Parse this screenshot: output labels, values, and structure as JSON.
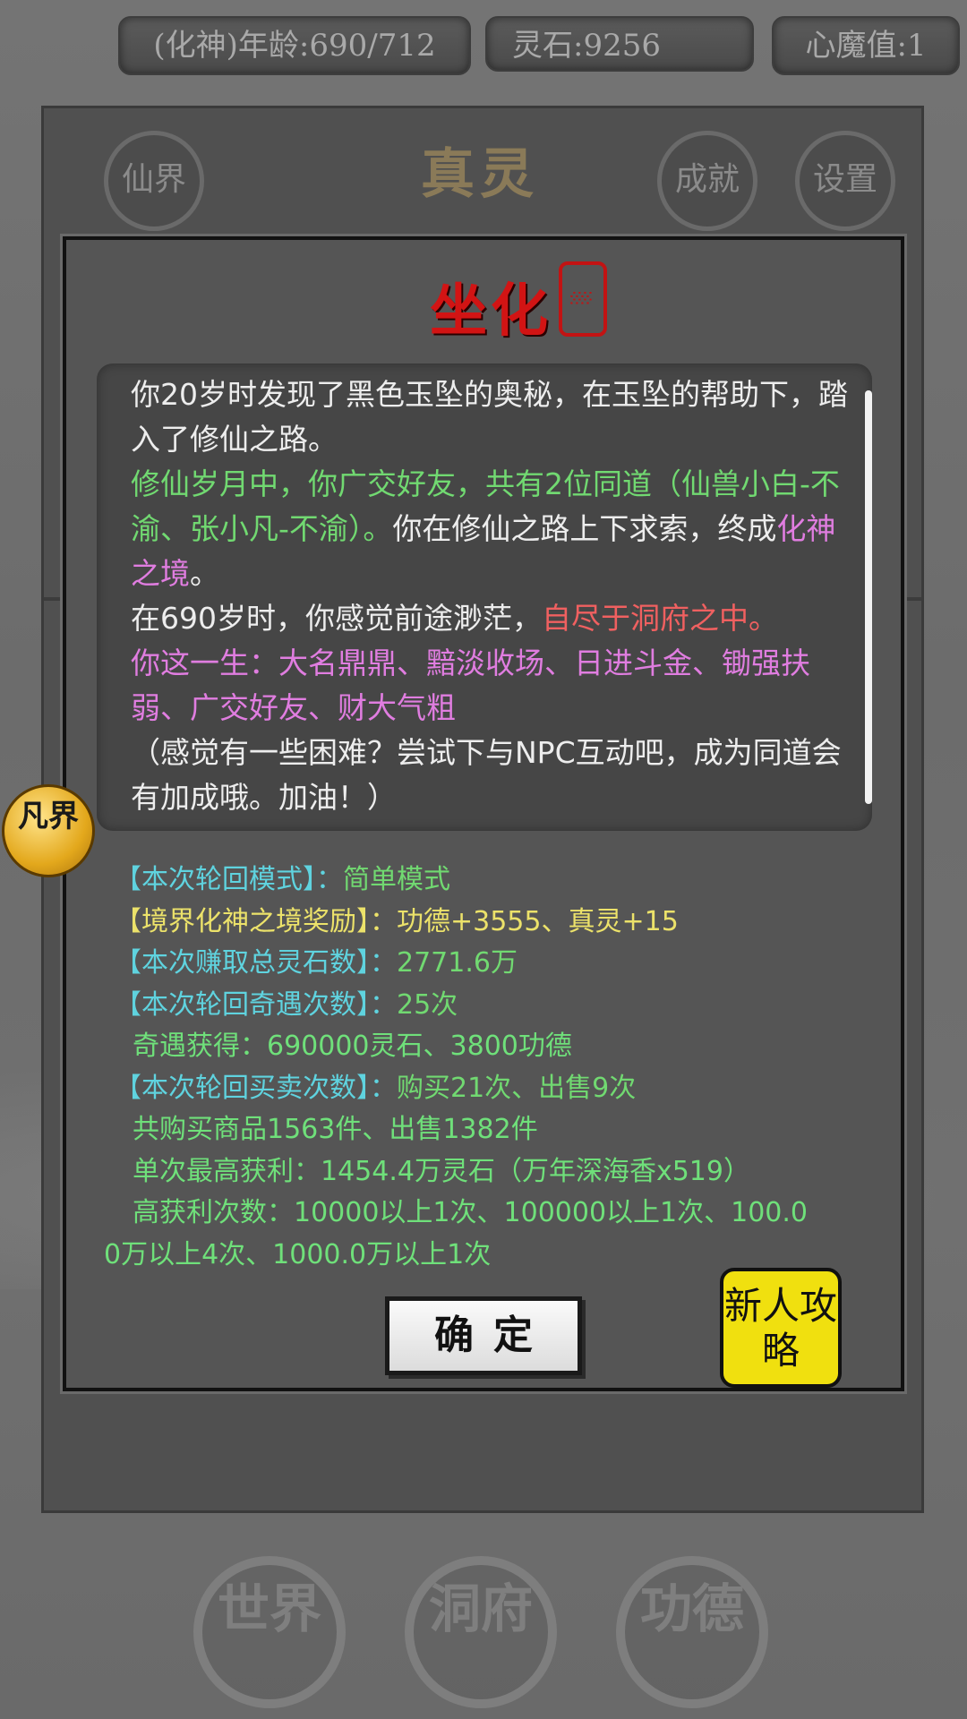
{
  "stats": {
    "age": "(化神)年龄:690/712",
    "spirit_stone": "灵石:9256",
    "heart_demon": "心魔值:1"
  },
  "top_nav": {
    "xianjie": "仙界",
    "title": "真灵",
    "chengjiu": "成就",
    "shezhi": "设置"
  },
  "modal": {
    "title": "坐化",
    "story": [
      "你20岁时发现了黑色玉坠的奥秘，在玉坠的帮助下，踏入了修仙之路。",
      "修仙岁月中，你广交好友，共有2位同道（仙兽小白-不渝、张小凡-不渝）。",
      "你在修仙之路上下求索，终成",
      "化神之境",
      "。",
      "在690岁时，你感觉前途渺茫，",
      "自尽于洞府之中。",
      "你这一生：大名鼎鼎、黯淡收场、日进斗金、锄强扶弱、广交好友、财大气粗",
      "（感觉有一些困难？尝试下与NPC互动吧，成为同道会有加成哦。加油！）"
    ],
    "summary": {
      "mode_label": "【本次轮回模式】：",
      "mode_value": "简单模式",
      "reward_label": "【境界化神之境奖励】：",
      "reward_value": "功德+3555、真灵+15",
      "earn_label": "【本次赚取总灵石数】：",
      "earn_value": "2771.6万",
      "encounter_label": "【本次轮回奇遇次数】：",
      "encounter_value": "25次",
      "encounter_gain": "奇遇获得：690000灵石、3800功德",
      "trade_label": "【本次轮回买卖次数】：",
      "trade_value": "购买21次、出售9次",
      "trade_goods": "共购买商品1563件、出售1382件",
      "best_profit": "单次最高获利：1454.4万灵石（万年深海香x519）",
      "profit_counts_1": "高获利次数：10000以上1次、100000以上1次、100.0",
      "profit_counts_2": "0万以上4次、1000.0万以上1次"
    },
    "confirm": "确定",
    "guide": "新人攻略"
  },
  "side": {
    "fanjie": "凡界"
  },
  "bottom_nav": {
    "world": "世界",
    "cave": "洞府",
    "merit": "功德"
  }
}
